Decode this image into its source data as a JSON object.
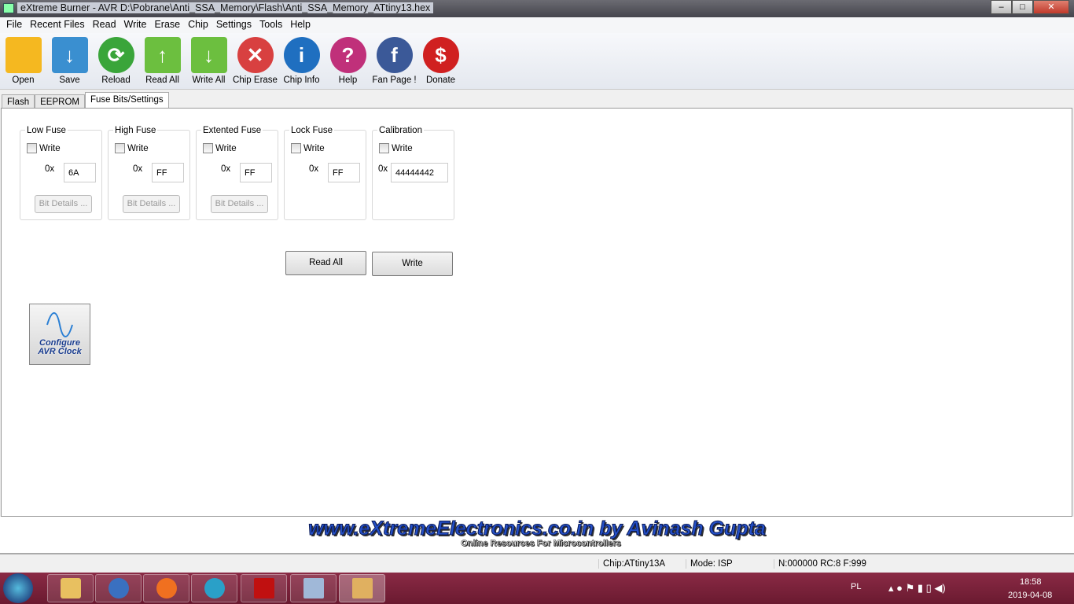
{
  "window": {
    "title": "eXtreme Burner - AVR D:\\Pobrane\\Anti_SSA_Memory\\Flash\\Anti_SSA_Memory_ATtiny13.hex",
    "minimize": "–",
    "maximize": "□",
    "close": "✕"
  },
  "menu": [
    "File",
    "Recent Files",
    "Read",
    "Write",
    "Erase",
    "Chip",
    "Settings",
    "Tools",
    "Help"
  ],
  "toolbar": [
    {
      "label": "Open",
      "icon": "folder-icon",
      "color": "#f5b820",
      "glyph": ""
    },
    {
      "label": "Save",
      "icon": "save-icon",
      "color": "#3a8fd0",
      "glyph": "↓"
    },
    {
      "label": "Reload",
      "icon": "reload-icon",
      "color": "#3aa53a",
      "glyph": "⟳"
    },
    {
      "label": "Read All",
      "icon": "read-all-icon",
      "color": "#6cbf3f",
      "glyph": "↑"
    },
    {
      "label": "Write All",
      "icon": "write-all-icon",
      "color": "#6cbf3f",
      "glyph": "↓"
    },
    {
      "label": "Chip Erase",
      "icon": "broom-erase-icon",
      "color": "#d84040",
      "glyph": "✕"
    },
    {
      "label": "Chip Info",
      "icon": "info-icon",
      "color": "#1f6fc0",
      "glyph": "i"
    },
    {
      "label": "Help",
      "icon": "help-icon",
      "color": "#c0307a",
      "glyph": "?"
    },
    {
      "label": "Fan Page !",
      "icon": "facebook-icon",
      "color": "#3b5998",
      "glyph": "f"
    },
    {
      "label": "Donate",
      "icon": "dollar-icon",
      "color": "#d02020",
      "glyph": "$"
    }
  ],
  "tabs": [
    "Flash",
    "EEPROM",
    "Fuse Bits/Settings"
  ],
  "fuses": [
    {
      "title": "Low Fuse",
      "write_label": "Write",
      "checked": false,
      "prefix": "0x",
      "value": "6A",
      "details": "Bit Details ..."
    },
    {
      "title": "High Fuse",
      "write_label": "Write",
      "checked": false,
      "prefix": "0x",
      "value": "FF",
      "details": "Bit Details ..."
    },
    {
      "title": "Extented Fuse",
      "write_label": "Write",
      "checked": false,
      "prefix": "0x",
      "value": "FF",
      "details": "Bit Details ..."
    },
    {
      "title": "Lock Fuse",
      "write_label": "Write",
      "checked": false,
      "prefix": "0x",
      "value": "FF"
    },
    {
      "title": "Calibration",
      "write_label": "Write",
      "checked": false,
      "prefix": "0x",
      "value": "44444442"
    }
  ],
  "actions": {
    "read_all": "Read All",
    "write": "Write"
  },
  "configure_clock": {
    "label": "Configure AVR Clock"
  },
  "banner": {
    "line1": "www.eXtremeElectronics.co.in by Avinash Gupta",
    "line2": "Online Resources For Microcontrollers"
  },
  "status": {
    "chip": "Chip:ATtiny13A",
    "mode": "Mode: ISP",
    "info": "N:000000 RC:8 F:999"
  },
  "taskbar": {
    "language": "PL",
    "time": "18:58",
    "date": "2019-04-08"
  }
}
